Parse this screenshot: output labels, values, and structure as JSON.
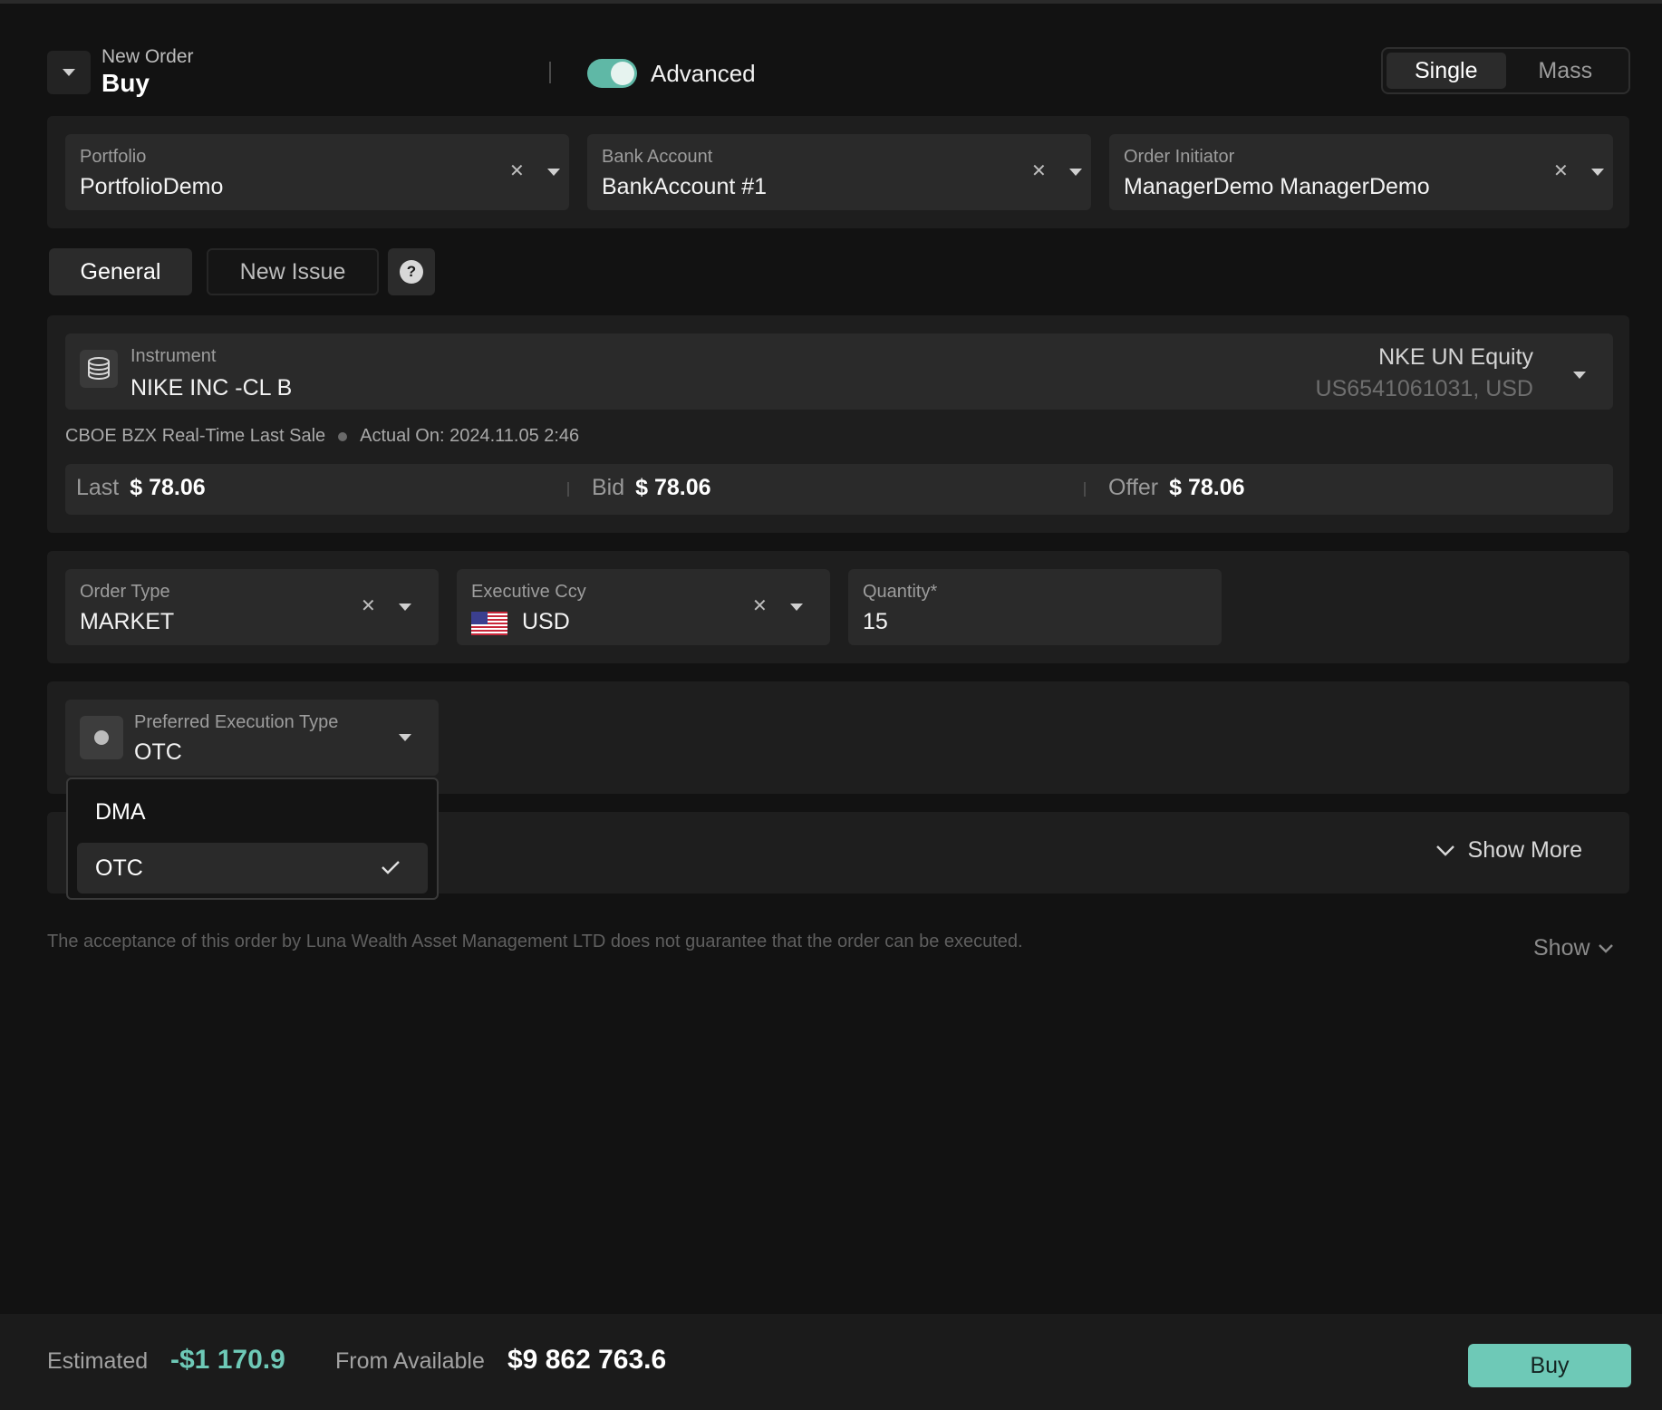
{
  "header": {
    "subtitle": "New Order",
    "title": "Buy",
    "advanced_label": "Advanced",
    "advanced_on": true,
    "mode_options": [
      "Single",
      "Mass"
    ],
    "mode_selected": "Single"
  },
  "accounts": {
    "portfolio": {
      "label": "Portfolio",
      "value": "PortfolioDemo"
    },
    "bank_account": {
      "label": "Bank Account",
      "value": "BankAccount #1"
    },
    "order_initiator": {
      "label": "Order Initiator",
      "value": "ManagerDemo ManagerDemo"
    }
  },
  "tabs": [
    {
      "label": "General",
      "active": true
    },
    {
      "label": "New Issue",
      "active": false
    }
  ],
  "help_glyph": "?",
  "instrument": {
    "label": "Instrument",
    "name": "NIKE INC -CL B",
    "ticker": "NKE UN Equity",
    "isin_ccy": "US6541061031, USD",
    "feed": "CBOE BZX Real-Time Last Sale",
    "actual_on": "Actual On: 2024.11.05 2:46"
  },
  "quotes": [
    {
      "label": "Last",
      "value": "$ 78.06"
    },
    {
      "label": "Bid",
      "value": "$ 78.06"
    },
    {
      "label": "Offer",
      "value": "$ 78.06"
    }
  ],
  "order": {
    "order_type": {
      "label": "Order Type",
      "value": "MARKET"
    },
    "exec_ccy": {
      "label": "Executive Ccy",
      "value": "USD"
    },
    "quantity": {
      "label": "Quantity*",
      "value": "15"
    }
  },
  "execution": {
    "label": "Preferred Execution Type",
    "value": "OTC",
    "options": [
      {
        "label": "DMA",
        "selected": false
      },
      {
        "label": "OTC",
        "selected": true
      }
    ]
  },
  "show_more_label": "Show More",
  "disclaimer": "The acceptance of this order by Luna Wealth Asset Management LTD does not guarantee that the order can be executed.",
  "show_label": "Show",
  "footer": {
    "estimated_label": "Estimated",
    "estimated_value": "-$1 170.9",
    "available_label": "From Available",
    "available_value": "$9 862 763.6",
    "buy_label": "Buy"
  },
  "colors": {
    "accent": "#6ec9b7",
    "toggle": "#5fb8a6",
    "estimated": "#6ec9b7",
    "background": "#121212",
    "panel": "#1e1e1e",
    "field": "#2a2a2a"
  },
  "icons": {
    "collapse": "caret-down-icon",
    "clear": "close-icon",
    "dropdown": "caret-down-icon",
    "instrument": "coins-stack-icon",
    "help": "question-icon",
    "flag": "us-flag-icon",
    "check": "check-icon",
    "expand": "chevron-down-icon"
  }
}
